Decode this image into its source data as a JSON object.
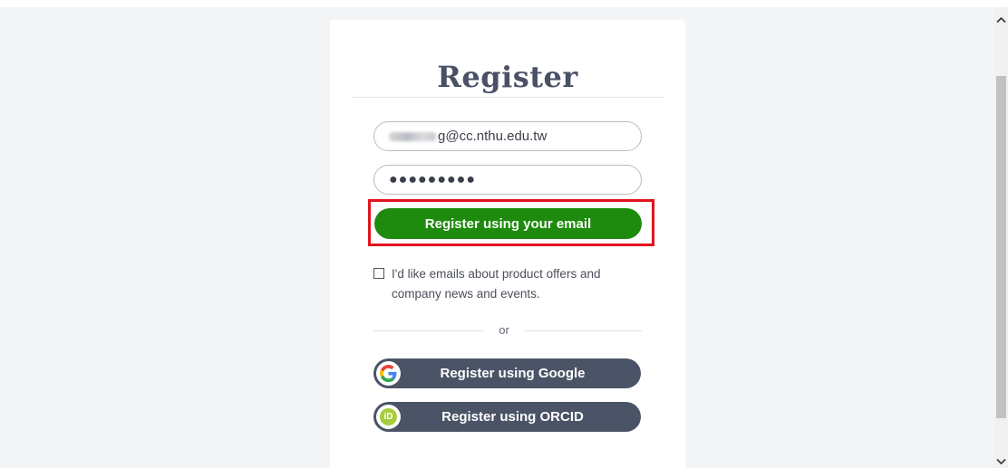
{
  "register": {
    "title": "Register",
    "email_value_visible": "g@cc.nthu.edu.tw",
    "password_mask": "●●●●●●●●●",
    "email_button_label": "Register using your email",
    "optin_label": "I'd like emails about product offers and company news and events.",
    "divider_text": "or",
    "google_button_label": "Register using Google",
    "orcid_button_label": "Register using ORCID",
    "orcid_glyph": "iD"
  },
  "colors": {
    "primary_button": "#1e8a0e",
    "social_button": "#4a5466",
    "highlight_box": "#e0141e",
    "orcid_green": "#a6ce39"
  },
  "icons": [
    "google-icon",
    "orcid-icon",
    "scroll-up-icon",
    "scroll-down-icon"
  ]
}
